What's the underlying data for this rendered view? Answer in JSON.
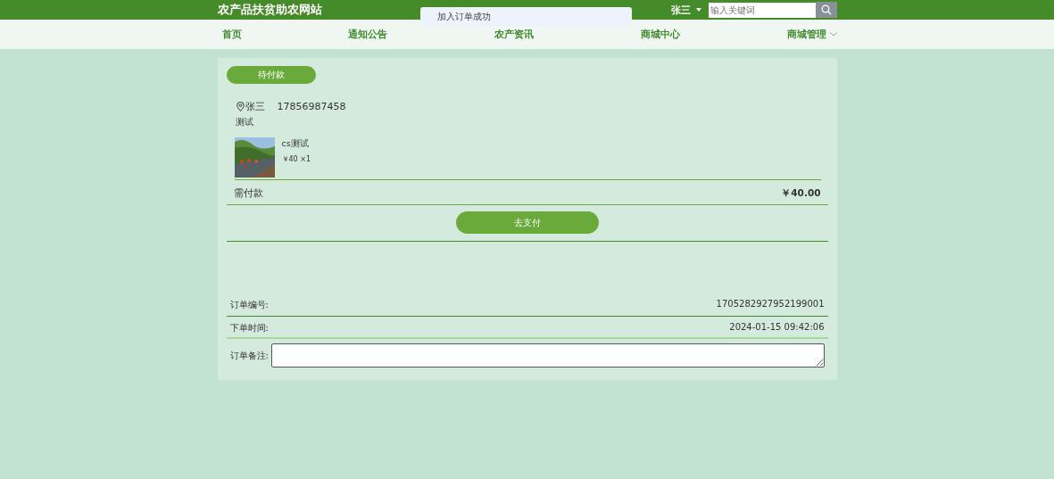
{
  "site_title": "农产品扶贫助农网站",
  "user": {
    "name": "张三"
  },
  "search": {
    "placeholder": "输入关键词"
  },
  "toast": {
    "message": "加入订单成功"
  },
  "nav": [
    {
      "label": "首页",
      "has_menu": false
    },
    {
      "label": "通知公告",
      "has_menu": false
    },
    {
      "label": "农产资讯",
      "has_menu": false
    },
    {
      "label": "商城中心",
      "has_menu": false
    },
    {
      "label": "商城管理",
      "has_menu": true
    }
  ],
  "order": {
    "status": "待付款",
    "address": {
      "name": "张三",
      "phone": "17856987458",
      "detail": "测试"
    },
    "items": [
      {
        "kind": "picture",
        "name": "cs测试",
        "price": "￥40 ×1"
      }
    ],
    "total_label": "需付款",
    "total": "￥40.00",
    "pay_button": "去支付",
    "info": [
      {
        "label": "订单编号:",
        "value": "1705282927952199001"
      },
      {
        "label": "下单时间:",
        "value": "2024-01-15 09:42:06"
      }
    ],
    "remark": {
      "label": "订单备注:"
    }
  }
}
